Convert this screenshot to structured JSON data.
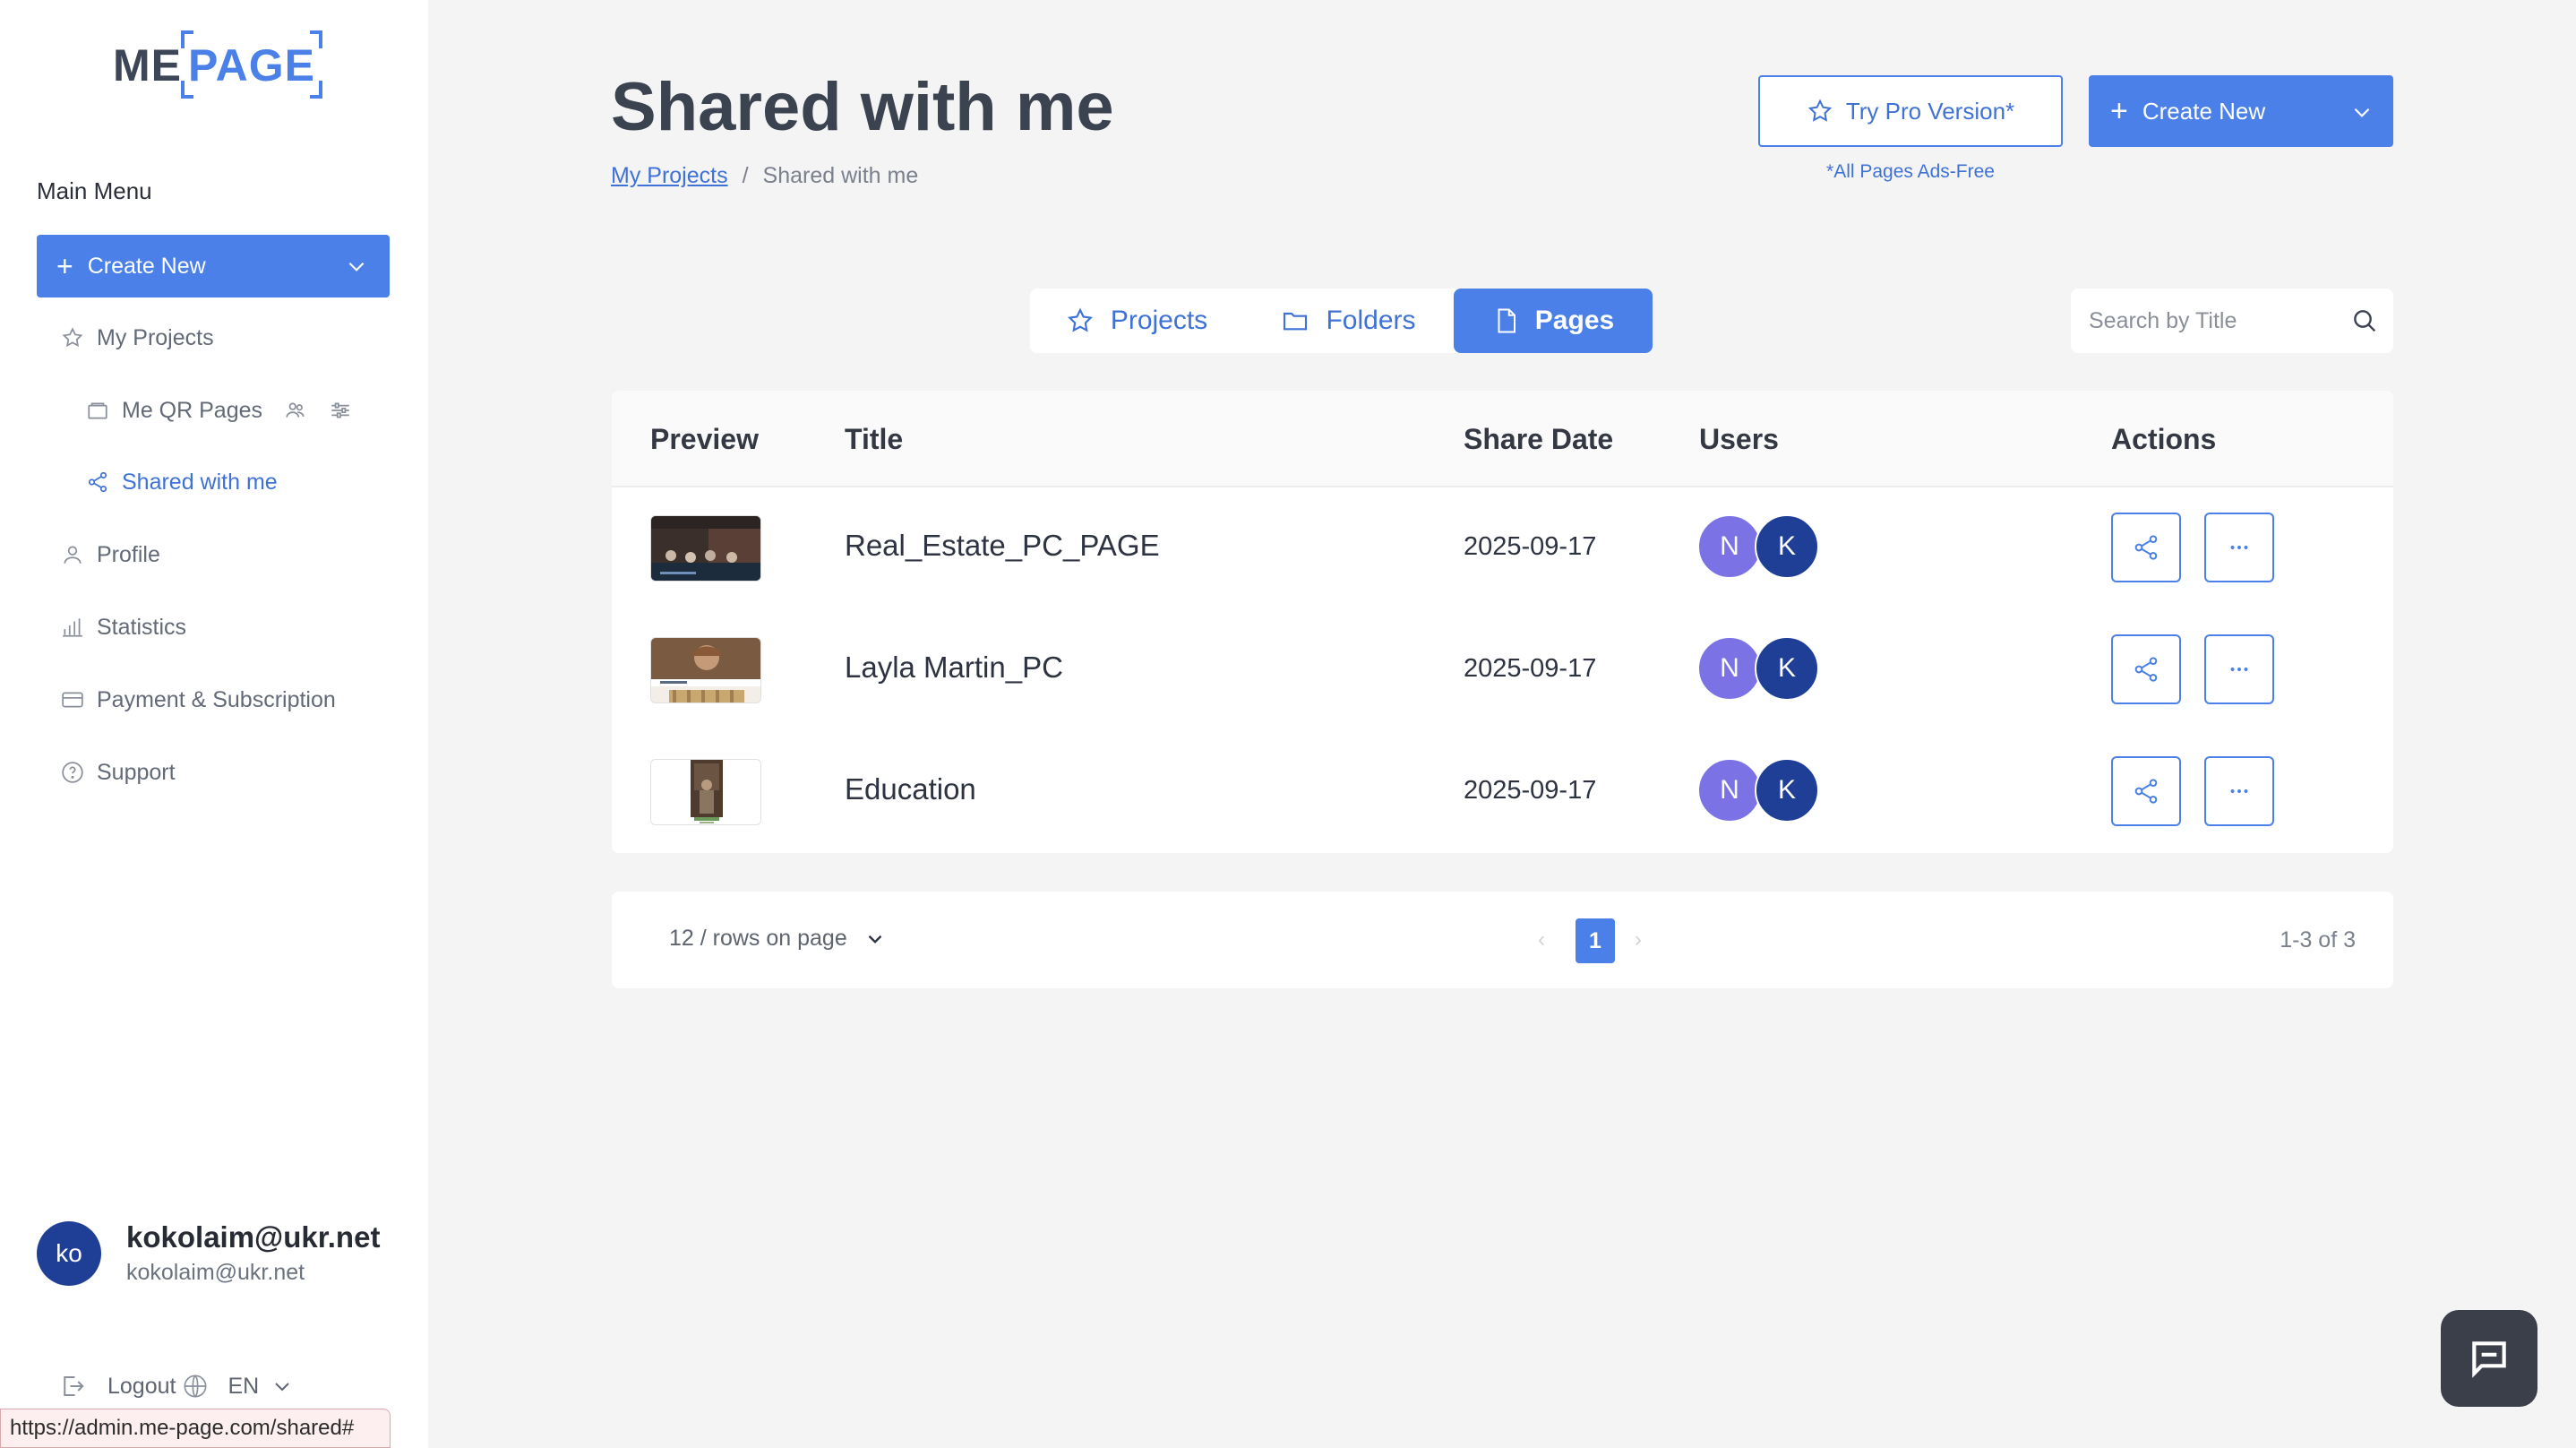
{
  "app": {
    "logo_left": "ME",
    "logo_right": "PAGE"
  },
  "sidebar": {
    "menu_title": "Main Menu",
    "create_label": "Create New",
    "items": [
      {
        "label": "My Projects",
        "icon": "star-icon"
      },
      {
        "label": "Me QR Pages",
        "icon": "folder-icon"
      },
      {
        "label": "Shared with me",
        "icon": "share-icon",
        "active": true
      },
      {
        "label": "Profile",
        "icon": "user-icon"
      },
      {
        "label": "Statistics",
        "icon": "bar-chart-icon"
      },
      {
        "label": "Payment & Subscription",
        "icon": "credit-card-icon"
      },
      {
        "label": "Support",
        "icon": "help-circle-icon"
      }
    ]
  },
  "user": {
    "initials": "ko",
    "email": "kokolaim@ukr.net",
    "email_sub": "kokolaim@ukr.net"
  },
  "footer": {
    "logout_label": "Logout",
    "lang": "EN"
  },
  "status_url": "https://admin.me-page.com/shared#",
  "header": {
    "title": "Shared with me",
    "breadcrumb_link": "My Projects",
    "breadcrumb_sep": "/",
    "breadcrumb_current": "Shared with me",
    "pro_label": "Try Pro Version*",
    "pro_note": "*All Pages Ads-Free",
    "create_label": "Create New"
  },
  "tabs": [
    {
      "label": "Projects",
      "icon": "star-icon"
    },
    {
      "label": "Folders",
      "icon": "folder-icon"
    },
    {
      "label": "Pages",
      "icon": "file-icon",
      "active": true
    }
  ],
  "search": {
    "placeholder": "Search by Title"
  },
  "table": {
    "columns": [
      "Preview",
      "Title",
      "Share Date",
      "Users",
      "Actions"
    ],
    "rows": [
      {
        "title": "Real_Estate_PC_PAGE",
        "date": "2025-09-17",
        "users": [
          "N",
          "K"
        ]
      },
      {
        "title": "Layla Martin_PC",
        "date": "2025-09-17",
        "users": [
          "N",
          "K"
        ]
      },
      {
        "title": "Education",
        "date": "2025-09-17",
        "users": [
          "N",
          "K"
        ]
      }
    ]
  },
  "pagination": {
    "rows_label": "12 / rows on page",
    "prev": "‹",
    "next": "›",
    "current_page": "1",
    "total_label": "1-3 of 3"
  },
  "colors": {
    "accent": "#4a80e8",
    "avatar_n": "#7b72e6",
    "avatar_k": "#1f3f96",
    "chat": "#3a3f4a"
  }
}
